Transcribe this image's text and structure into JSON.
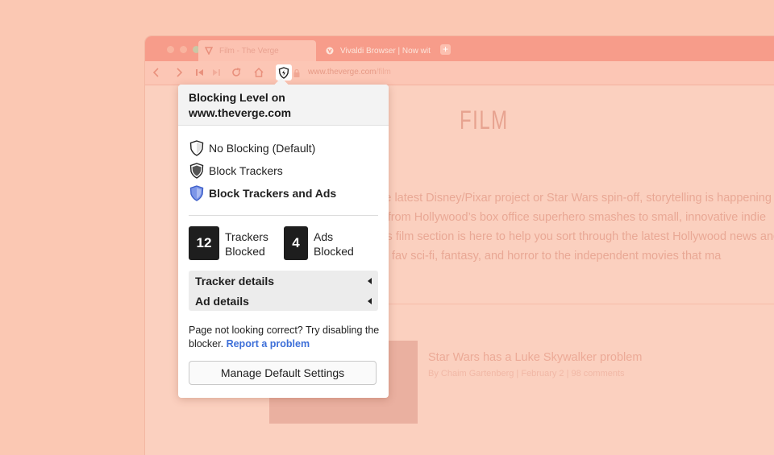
{
  "colors": {
    "link": "#3d6fd8",
    "shield_active": "#7d96e8",
    "badge": "#1e1e1e"
  },
  "browser": {
    "tabs": [
      {
        "label": "Film - The Verge",
        "icon": "verge-icon"
      },
      {
        "label": "Vivaldi Browser | Now wit",
        "icon": "vivaldi-icon"
      }
    ],
    "new_tab_label": "+",
    "address": {
      "domain": "www.theverge.com",
      "path": "/film"
    }
  },
  "page": {
    "title": "FILM",
    "intro": "Cinema isn’t just about the latest Disney/Pixar project or Star Wars spin-off, storytelling is happening all over the film industry, from Hollywood’s box office superhero smashes to small, innovative indie experiments. The Verge’s film section is here to help you sort through the latest Hollywood news and reviews, from fav sci-fi, fantasy, and horror to the independent movies that ma",
    "article": {
      "title": "Star Wars has a Luke Skywalker problem",
      "meta": "By Chaim Gartenberg  |  February 2  |  98 comments"
    }
  },
  "popup": {
    "heading": "Blocking Level on www.theverge.com",
    "options": [
      {
        "label": "No Blocking",
        "suffix": "(Default)",
        "icon": "shield-outline-icon"
      },
      {
        "label": "Block Trackers",
        "icon": "shield-half-icon"
      },
      {
        "label": "Block Trackers and Ads",
        "icon": "shield-full-icon",
        "selected": true
      }
    ],
    "stats": [
      {
        "count": "12",
        "line1": "Trackers",
        "line2": "Blocked"
      },
      {
        "count": "4",
        "line1": "Ads",
        "line2": "Blocked"
      }
    ],
    "details": [
      {
        "label": "Tracker details"
      },
      {
        "label": "Ad details"
      }
    ],
    "note_text": "Page not looking correct? Try disabling the blocker.",
    "report_link": "Report a problem",
    "manage_button": "Manage Default Settings"
  }
}
